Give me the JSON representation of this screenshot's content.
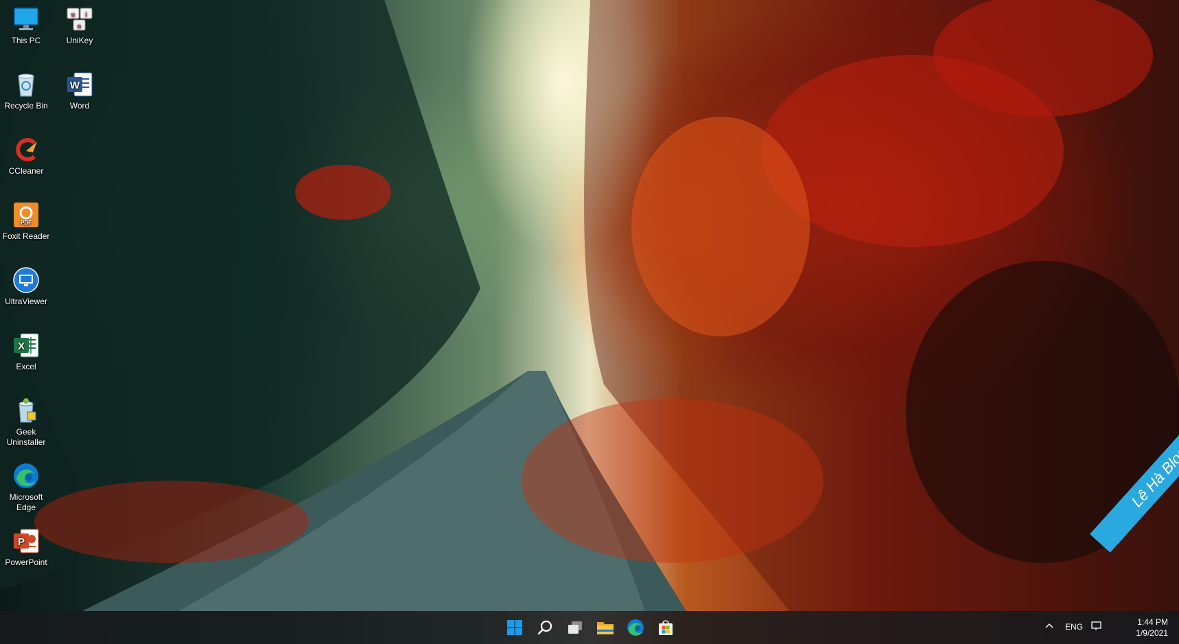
{
  "desktop": {
    "icons": [
      {
        "label": "This PC",
        "icon": "computer-icon"
      },
      {
        "label": "UniKey",
        "icon": "unikey-icon"
      },
      {
        "label": "Recycle Bin",
        "icon": "recycle-bin-icon"
      },
      {
        "label": "Word",
        "icon": "word-icon"
      },
      {
        "label": "CCleaner",
        "icon": "ccleaner-icon"
      },
      {
        "label": "Foxit Reader",
        "icon": "foxit-reader-icon"
      },
      {
        "label": "UltraViewer",
        "icon": "ultraviewer-icon"
      },
      {
        "label": "Excel",
        "icon": "excel-icon"
      },
      {
        "label": "Geek Uninstaller",
        "icon": "geek-uninstaller-icon"
      },
      {
        "label": "Microsoft Edge",
        "icon": "edge-icon"
      },
      {
        "label": "PowerPoint",
        "icon": "powerpoint-icon"
      }
    ],
    "unikey_letters": [
      "u",
      "i",
      "n"
    ],
    "word_letter": "W",
    "excel_letter": "X",
    "foxit_letter": "PDF",
    "powerpoint_letter": "P"
  },
  "taskbar": {
    "buttons": [
      {
        "name": "start-button",
        "icon": "windows-logo-icon"
      },
      {
        "name": "search-button",
        "icon": "search-icon"
      },
      {
        "name": "task-view-button",
        "icon": "task-view-icon"
      },
      {
        "name": "file-explorer-button",
        "icon": "folder-icon"
      },
      {
        "name": "edge-taskbar-button",
        "icon": "edge-icon"
      },
      {
        "name": "store-button",
        "icon": "store-icon"
      }
    ],
    "tray": {
      "language": "ENG",
      "time": "1:44 PM",
      "date": "1/9/2021"
    }
  },
  "watermark": {
    "text": "Lê Hà Blog"
  },
  "colors": {
    "taskbar": "#181a1e",
    "accent": "#0078d4",
    "watermark": "#2aa8e0"
  }
}
